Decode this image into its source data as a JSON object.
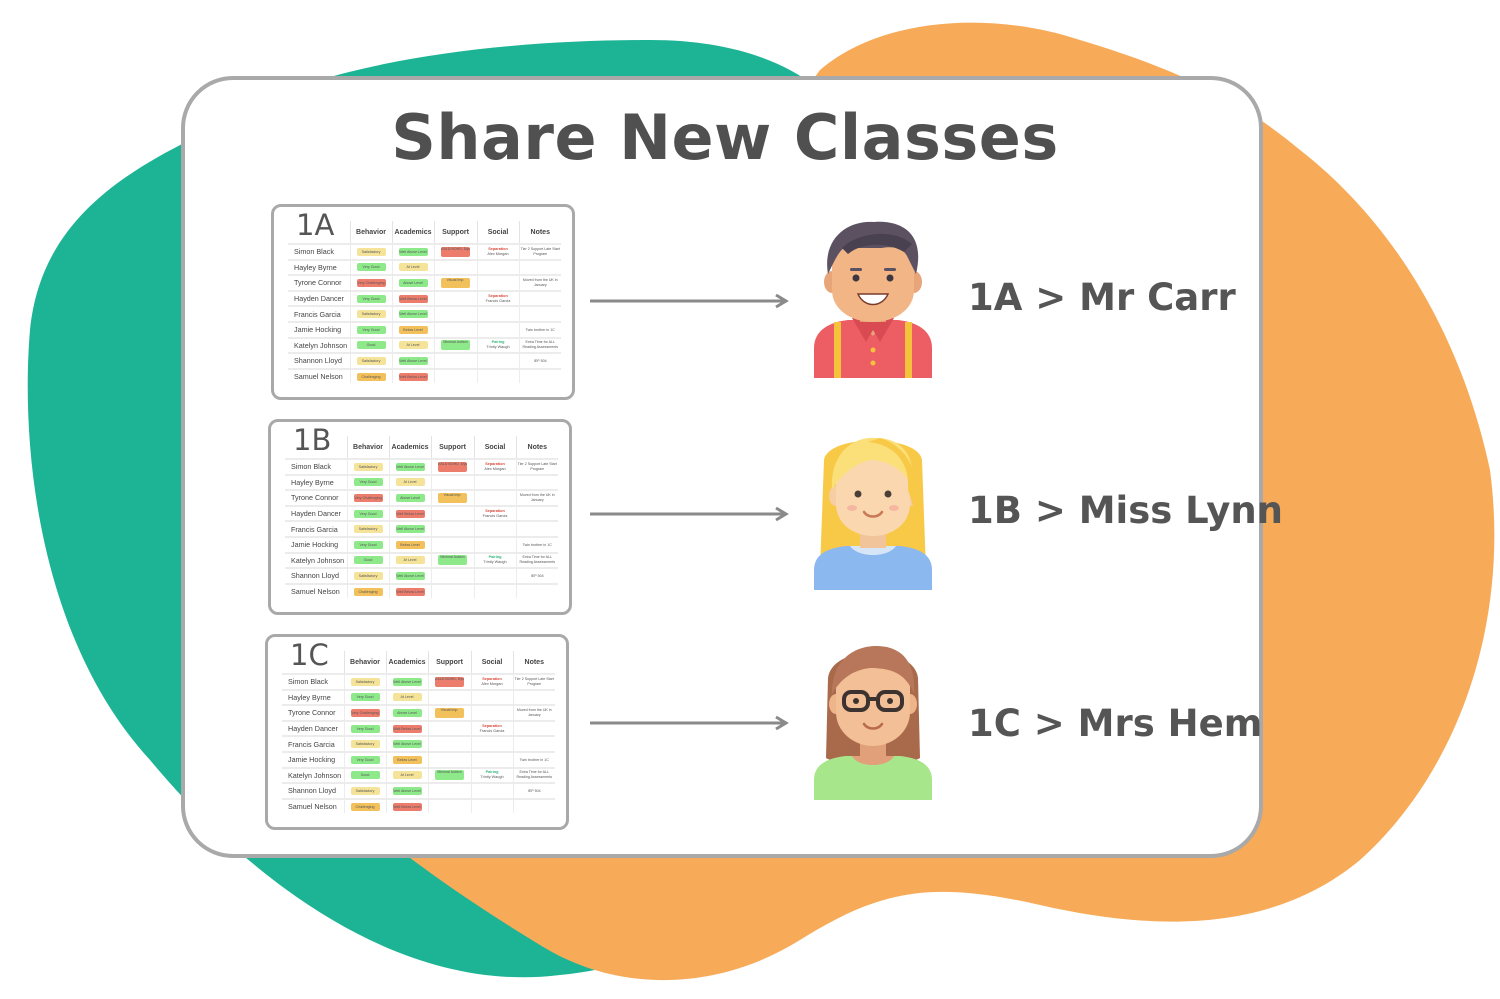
{
  "title": "Share New Classes",
  "colors": {
    "teal_blob": "#1db495",
    "orange_blob": "#f7ab59",
    "card_border": "#a9a9a9",
    "text": "#505050",
    "chip_green": "#8ee98a",
    "chip_yellow": "#f5e39a",
    "chip_orange": "#f2c15c",
    "chip_red": "#ec7d6c"
  },
  "columns": [
    "Behavior",
    "Academics",
    "Support",
    "Social",
    "Notes"
  ],
  "students": [
    {
      "name": "Simon Black",
      "behavior": "Satisfactory",
      "behavior_color": "yellow",
      "academics": "Well Above Level",
      "academics_color": "green",
      "support": "EALD BOHD, Dyslexia",
      "support_color": "red",
      "social_label": "Separation",
      "social_tone": "red",
      "social_detail": "Alex Morgan",
      "notes": "Tier 2 Support Late Start Program"
    },
    {
      "name": "Hayley Byrne",
      "behavior": "Very Good",
      "behavior_color": "green",
      "academics": "At Level",
      "academics_color": "yellow",
      "support": "",
      "support_color": "",
      "social_label": "",
      "social_tone": "",
      "social_detail": "",
      "notes": ""
    },
    {
      "name": "Tyrone Connor",
      "behavior": "Very Challenging",
      "behavior_color": "red",
      "academics": "Above Level",
      "academics_color": "green",
      "support": "Visual Imp.",
      "support_color": "orange",
      "social_label": "",
      "social_tone": "",
      "social_detail": "",
      "notes": "Moved from the UK in January"
    },
    {
      "name": "Hayden Dancer",
      "behavior": "Very Good",
      "behavior_color": "green",
      "academics": "Well Below Level",
      "academics_color": "red",
      "support": "",
      "support_color": "",
      "social_label": "Separation",
      "social_tone": "red",
      "social_detail": "Francis Garcia",
      "notes": ""
    },
    {
      "name": "Francis Garcia",
      "behavior": "Satisfactory",
      "behavior_color": "yellow",
      "academics": "Well Above Level",
      "academics_color": "green",
      "support": "",
      "support_color": "",
      "social_label": "",
      "social_tone": "",
      "social_detail": "",
      "notes": ""
    },
    {
      "name": "Jamie Hocking",
      "behavior": "Very Good",
      "behavior_color": "green",
      "academics": "Below Level",
      "academics_color": "orange",
      "support": "",
      "support_color": "",
      "social_label": "",
      "social_tone": "",
      "social_detail": "",
      "notes": "Twin brother in 1C"
    },
    {
      "name": "Katelyn Johnson",
      "behavior": "Good",
      "behavior_color": "green",
      "academics": "At Level",
      "academics_color": "yellow",
      "support": "Minimal Autism",
      "support_color": "green",
      "social_label": "Pairing",
      "social_tone": "green",
      "social_detail": "Trinity Waugh",
      "notes": "Extra Time for ALL Reading Assessments"
    },
    {
      "name": "Shannon Lloyd",
      "behavior": "Satisfactory",
      "behavior_color": "yellow",
      "academics": "Well Above Level",
      "academics_color": "green",
      "support": "",
      "support_color": "",
      "social_label": "",
      "social_tone": "",
      "social_detail": "",
      "notes": "IEP 504"
    },
    {
      "name": "Samuel Nelson",
      "behavior": "Challenging",
      "behavior_color": "orange",
      "academics": "Well Below Level",
      "academics_color": "red",
      "support": "",
      "support_color": "",
      "social_label": "",
      "social_tone": "",
      "social_detail": "",
      "notes": ""
    }
  ],
  "classes": [
    {
      "label": "1A",
      "assignment": "1A > Mr Carr",
      "teacher_icon": "male-teacher-avatar-icon"
    },
    {
      "label": "1B",
      "assignment": "1B > Miss Lynn",
      "teacher_icon": "blonde-female-teacher-avatar-icon"
    },
    {
      "label": "1C",
      "assignment": "1C > Mrs Hem",
      "teacher_icon": "female-teacher-glasses-avatar-icon"
    }
  ],
  "arrow_icon": "right-arrow-icon"
}
